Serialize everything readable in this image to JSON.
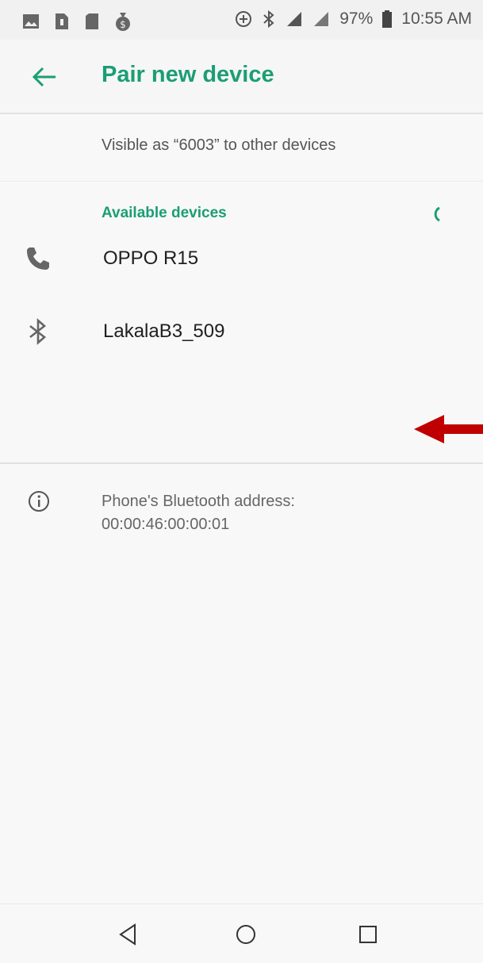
{
  "status_bar": {
    "left_icons": [
      "image-icon",
      "sim-icon",
      "sd-card-icon",
      "money-bag-icon"
    ],
    "right_icons": [
      "data-saver-icon",
      "bluetooth-icon",
      "signal-icon",
      "signal-icon-2"
    ],
    "battery_percent": "97%",
    "time": "10:55 AM"
  },
  "app_bar": {
    "title": "Pair new device",
    "back_icon": "arrow-left-icon"
  },
  "visibility_text": "Visible as “6003” to other devices",
  "available": {
    "header": "Available devices",
    "scanning_icon": "progress-spinner-icon",
    "devices": [
      {
        "name": "OPPO R15",
        "icon": "phone-icon"
      },
      {
        "name": "LakalaB3_509",
        "icon": "bluetooth-icon"
      }
    ]
  },
  "bluetooth_address": {
    "icon": "info-icon",
    "label": "Phone's Bluetooth address:",
    "value": "00:00:46:00:00:01"
  },
  "annotation": {
    "icon": "red-arrow-left-icon",
    "color": "#c00000"
  },
  "nav_bar": [
    "back-triangle-icon",
    "home-circle-icon",
    "recents-square-icon"
  ],
  "colors": {
    "accent": "#1b9e74",
    "annotation": "#c00000"
  }
}
